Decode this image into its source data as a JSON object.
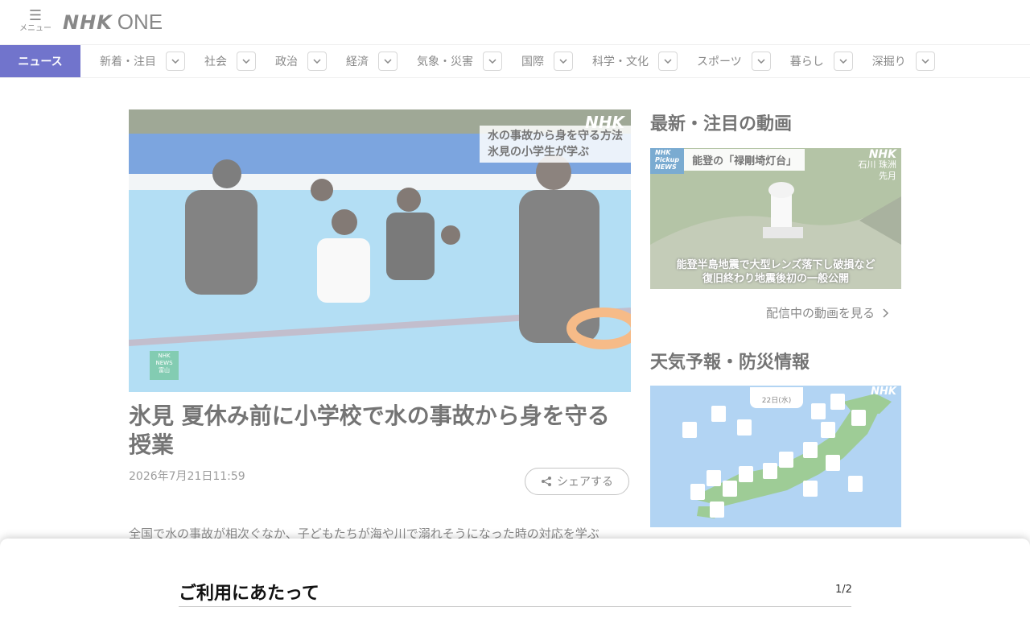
{
  "header": {
    "menu_label": "メニュー",
    "logo_nhk": "NHK",
    "logo_one": "ONE"
  },
  "nav": {
    "active": "ニュース",
    "items": [
      {
        "label": "新着・注目"
      },
      {
        "label": "社会"
      },
      {
        "label": "政治"
      },
      {
        "label": "経済"
      },
      {
        "label": "気象・災害"
      },
      {
        "label": "国際"
      },
      {
        "label": "科学・文化"
      },
      {
        "label": "スポーツ"
      },
      {
        "label": "暮らし"
      },
      {
        "label": "深掘り"
      }
    ]
  },
  "article": {
    "image": {
      "caption_line1": "水の事故から身を守る方法",
      "caption_line2": "氷見の小学生が学ぶ",
      "watermark": "NHK",
      "badge_line1": "NHK",
      "badge_line2": "NEWS",
      "badge_line3": "富山"
    },
    "title": "氷見 夏休み前に小学校で水の事故から身を守る授業",
    "date": "2026年7月21日11:59",
    "share_label": "シェアする",
    "body_first_line": "全国で水の事故が相次ぐなか、子どもたちが海や川で溺れそうになった時の対応を学ぶ"
  },
  "sidebar": {
    "video_heading": "最新・注目の動画",
    "video": {
      "pickup_line1": "NHK",
      "pickup_line2": "Pickup",
      "pickup_line3": "NEWS",
      "banner_title": "能登の「禄剛埼灯台」",
      "location_line1": "石川 珠洲",
      "location_line2": "先月",
      "watermark": "NHK",
      "caption_line1": "能登半島地震で大型レンズ落下し破損など",
      "caption_line2": "復旧終わり地震後初の一般公開"
    },
    "more_videos_label": "配信中の動画を見る",
    "weather_heading": "天気予報・防災情報",
    "weather": {
      "date_label": "22日(水)",
      "watermark": "NHK"
    }
  },
  "notice_sheet": {
    "title": "ご利用にあたって",
    "page_indicator": "1/2"
  },
  "colors": {
    "brand_blue": "#0b11a8"
  }
}
